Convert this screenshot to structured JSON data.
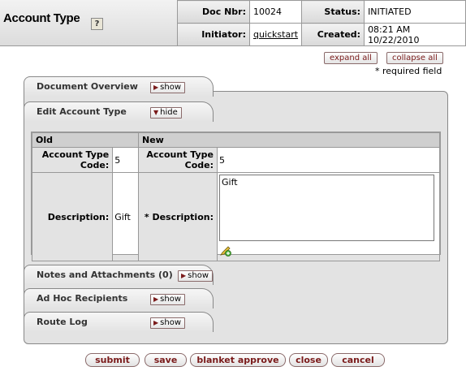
{
  "header": {
    "title": "Account Type",
    "help_icon": "?",
    "doc_nbr_label": "Doc Nbr:",
    "doc_nbr_value": "10024",
    "status_label": "Status:",
    "status_value": "INITIATED",
    "initiator_label": "Initiator:",
    "initiator_value": "quickstart",
    "created_label": "Created:",
    "created_value": "08:21 AM 10/22/2010"
  },
  "controls": {
    "expand_all": "expand all",
    "collapse_all": "collapse all",
    "required_note": "* required field"
  },
  "tabs": {
    "document_overview": {
      "label": "Document Overview",
      "toggle": "show"
    },
    "edit_account_type": {
      "label": "Edit Account Type",
      "toggle": "hide"
    },
    "notes": {
      "label": "Notes and Attachments (0)",
      "toggle": "show"
    },
    "adhoc": {
      "label": "Ad Hoc Recipients",
      "toggle": "show"
    },
    "route_log": {
      "label": "Route Log",
      "toggle": "show"
    }
  },
  "edit": {
    "old_header": "Old",
    "new_header": "New",
    "code_label": "Account Type Code:",
    "code_old": "5",
    "code_new": "5",
    "desc_label_old": "Description:",
    "desc_label_new": "* Description:",
    "desc_old": "Gift",
    "desc_new": "Gift"
  },
  "buttons": {
    "submit": "submit",
    "save": "save",
    "blanket_approve": "blanket approve",
    "close": "close",
    "cancel": "cancel"
  }
}
